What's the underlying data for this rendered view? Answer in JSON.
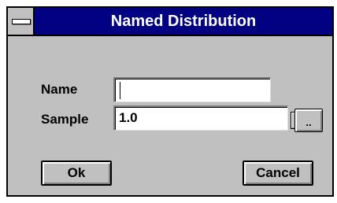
{
  "window": {
    "title": "Named Distribution",
    "system_menu_icon": "system-menu-icon"
  },
  "fields": {
    "name_label": "Name",
    "name_value": "",
    "sample_label": "Sample",
    "sample_value": "1.0",
    "dropdown_icon": "dropdown-arrow-icon",
    "browse_label": ".."
  },
  "buttons": {
    "ok_label": "Ok",
    "cancel_label": "Cancel"
  }
}
